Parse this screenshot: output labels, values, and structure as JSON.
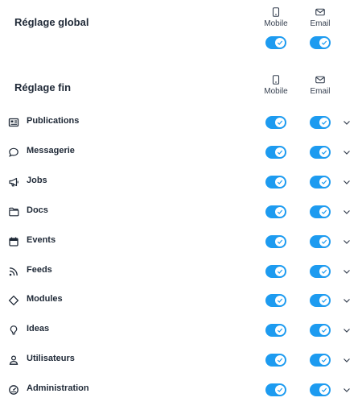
{
  "colors": {
    "accent": "#1d9bf0",
    "text": "#1f2937"
  },
  "global": {
    "title": "Réglage global",
    "mobile_label": "Mobile",
    "email_label": "Email",
    "mobile_on": true,
    "email_on": true
  },
  "fine": {
    "title": "Réglage fin",
    "mobile_label": "Mobile",
    "email_label": "Email",
    "rows": [
      {
        "label": "Publications",
        "icon": "newspaper-icon",
        "mobile_on": true,
        "email_on": true
      },
      {
        "label": "Messagerie",
        "icon": "chat-bubble-icon",
        "mobile_on": true,
        "email_on": true
      },
      {
        "label": "Jobs",
        "icon": "megaphone-icon",
        "mobile_on": true,
        "email_on": true
      },
      {
        "label": "Docs",
        "icon": "folder-icon",
        "mobile_on": true,
        "email_on": true
      },
      {
        "label": "Events",
        "icon": "calendar-icon",
        "mobile_on": true,
        "email_on": true
      },
      {
        "label": "Feeds",
        "icon": "rss-icon",
        "mobile_on": true,
        "email_on": true
      },
      {
        "label": "Modules",
        "icon": "diamond-icon",
        "mobile_on": true,
        "email_on": true
      },
      {
        "label": "Ideas",
        "icon": "lightbulb-icon",
        "mobile_on": true,
        "email_on": true
      },
      {
        "label": "Utilisateurs",
        "icon": "user-icon",
        "mobile_on": true,
        "email_on": true
      },
      {
        "label": "Administration",
        "icon": "gauge-icon",
        "mobile_on": true,
        "email_on": true
      }
    ]
  }
}
